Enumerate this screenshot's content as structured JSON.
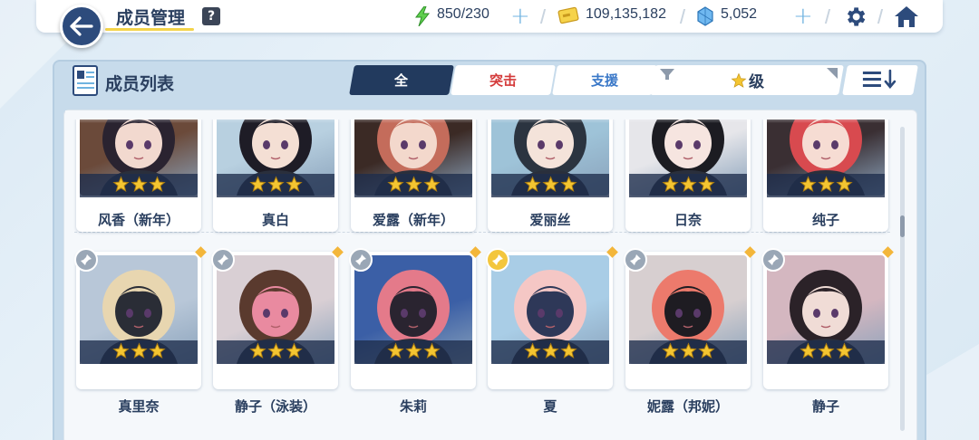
{
  "header": {
    "title": "成员管理",
    "help": "?",
    "energy": "850/230",
    "credits": "109,135,182",
    "pyroxene": "5,052"
  },
  "panel": {
    "title": "成员列表",
    "tabs": [
      {
        "label": "全"
      },
      {
        "label": "突击"
      },
      {
        "label": "支援"
      }
    ],
    "sort_label": "级"
  },
  "colors": {
    "accent": "#223a5e",
    "assault": "#d43a3a",
    "support": "#3a78c8",
    "star": "#f4c531",
    "highlight": "#f3d34a"
  },
  "rows": [
    {
      "members": [
        {
          "name": "风香（新年）",
          "stars": 3,
          "palette": [
            "#6b4a3a",
            "#2a2330",
            "#f2d9cf"
          ]
        },
        {
          "name": "真白",
          "stars": 3,
          "palette": [
            "#b8d0e0",
            "#1e1c26",
            "#f4dfd4"
          ]
        },
        {
          "name": "爱露（新年）",
          "stars": 3,
          "palette": [
            "#3b2a25",
            "#c46c5b",
            "#f3d8cc"
          ]
        },
        {
          "name": "爱丽丝",
          "stars": 3,
          "palette": [
            "#9ec3d8",
            "#2b3440",
            "#f4e3da"
          ]
        },
        {
          "name": "日奈",
          "stars": 3,
          "palette": [
            "#e6e6ea",
            "#1c1c22",
            "#f6e5e0"
          ]
        },
        {
          "name": "纯子",
          "stars": 3,
          "palette": [
            "#3a2f33",
            "#d84a4f",
            "#f6dcd3"
          ]
        }
      ]
    },
    {
      "members": [
        {
          "name": "真里奈",
          "stars": 3,
          "palette": [
            "#b8c7d8",
            "#e8d6b0",
            "#2a2d36"
          ],
          "pin": "grey"
        },
        {
          "name": "静子（泳装）",
          "stars": 3,
          "palette": [
            "#d9cfd4",
            "#5a3a2e",
            "#e98aa0"
          ],
          "pin": "grey"
        },
        {
          "name": "朱莉",
          "stars": 3,
          "palette": [
            "#3b5fa6",
            "#e47a8a",
            "#2a2430"
          ],
          "pin": "grey"
        },
        {
          "name": "夏",
          "stars": 3,
          "palette": [
            "#a9cde6",
            "#f5c7c5",
            "#2e3858"
          ],
          "pin": "gold"
        },
        {
          "name": "妮露（邦妮）",
          "stars": 3,
          "palette": [
            "#d7cfd0",
            "#ec7a6c",
            "#1e1c22"
          ],
          "pin": "grey"
        },
        {
          "name": "静子",
          "stars": 3,
          "palette": [
            "#d4b7c0",
            "#2b2228",
            "#f0dcd6"
          ],
          "pin": "grey"
        }
      ]
    }
  ]
}
